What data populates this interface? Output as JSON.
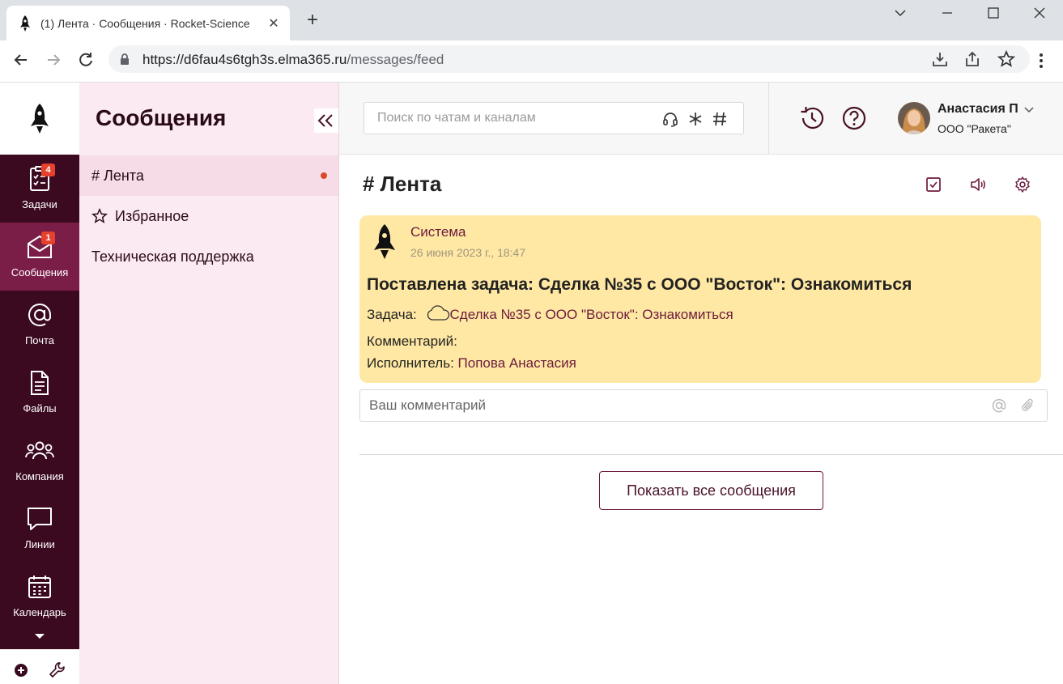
{
  "browser": {
    "tab_title": "(1)  Лента · Сообщения · Rocket-Science",
    "url_host": "https://d6fau4s6tgh3s.elma365.ru",
    "url_path": "/messages/feed"
  },
  "rail": {
    "items": [
      {
        "label": "Задачи",
        "icon": "tasks-icon",
        "badge": "4",
        "active": false
      },
      {
        "label": "Сообщения",
        "icon": "messages-icon",
        "badge": "1",
        "active": true
      },
      {
        "label": "Почта",
        "icon": "mail-at-icon",
        "badge": "",
        "active": false
      },
      {
        "label": "Файлы",
        "icon": "file-icon",
        "badge": "",
        "active": false
      },
      {
        "label": "Компания",
        "icon": "people-icon",
        "badge": "",
        "active": false
      },
      {
        "label": "Линии",
        "icon": "chat-bubble-icon",
        "badge": "",
        "active": false
      },
      {
        "label": "Календарь",
        "icon": "calendar-icon",
        "badge": "",
        "active": false
      }
    ]
  },
  "panel": {
    "title": "Сообщения",
    "channels": [
      {
        "label": "# Лента",
        "active": true,
        "unread": true
      },
      {
        "label": "Избранное",
        "active": false,
        "unread": false
      },
      {
        "label": "Техническая поддержка",
        "active": false,
        "unread": false
      }
    ]
  },
  "topbar": {
    "search_placeholder": "Поиск по чатам и каналам",
    "user_name": "Анастасия П",
    "user_org": "ООО \"Ракета\""
  },
  "feed": {
    "title": "# Лента",
    "message": {
      "author": "Система",
      "time": "26 июня 2023 г., 18:47",
      "headline": "Поставлена задача: Сделка №35 с ООО \"Восток\": Ознакомиться",
      "task_label": "Задача:",
      "task_link": "Сделка №35 с ООО \"Восток\": Ознакомиться",
      "comment_label": "Комментарий:",
      "assignee_label": "Исполнитель:",
      "assignee": "Попова Анастасия"
    },
    "comment_placeholder": "Ваш комментарий",
    "show_all_label": "Показать все сообщения"
  },
  "colors": {
    "rail_bg": "#3c0a20",
    "rail_active": "#7a1e47",
    "panel_bg": "#fbeaf1",
    "card_bg": "#ffe8a3",
    "accent": "#6c1b3d",
    "badge": "#e5412d"
  }
}
